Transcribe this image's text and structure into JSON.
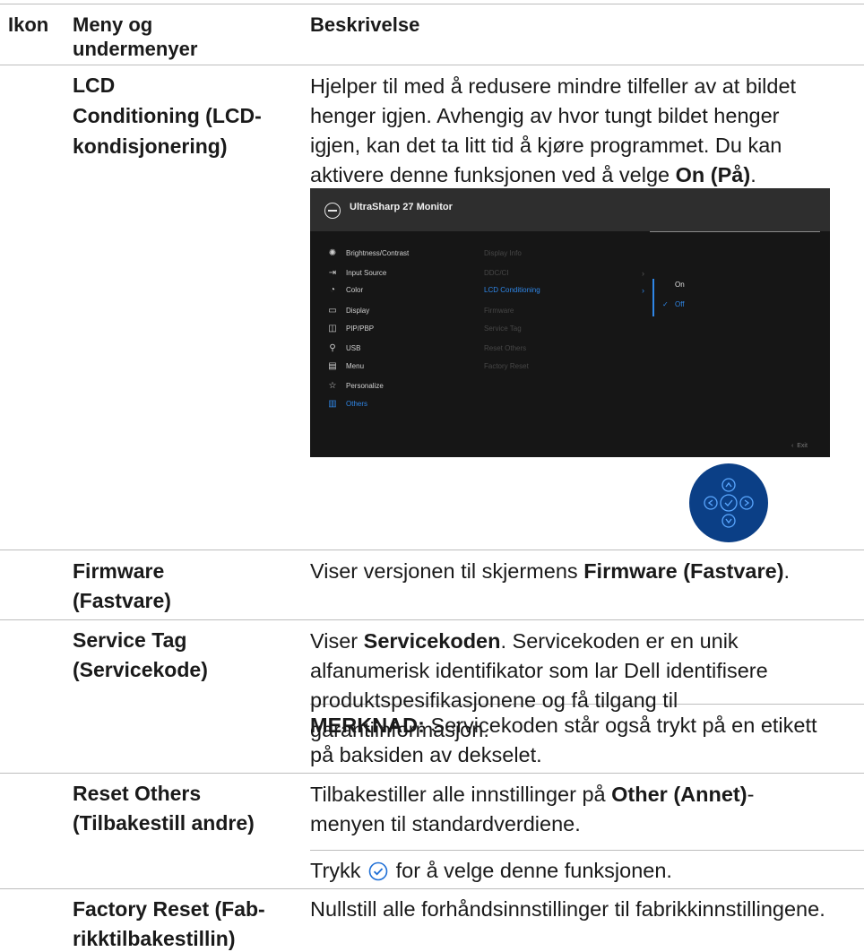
{
  "header": {
    "col_icon": "Ikon",
    "col_menu_line1": "Meny og",
    "col_menu_line2": "undermenyer",
    "col_desc": "Beskrivelse"
  },
  "rows": {
    "lcd": {
      "title_lines": [
        "LCD",
        "Conditioning (LCD-",
        "kondisjonering)"
      ],
      "desc_lines": [
        "Hjelper til med å redusere mindre tilfeller av at bildet",
        "henger igjen. Avhengig av hvor tungt bildet henger",
        "igjen, kan det ta litt tid å kjøre programmet. Du kan"
      ],
      "desc_last_prefix": "aktivere denne funksjonen ved å velge ",
      "desc_last_bold": "On (På)",
      "desc_last_suffix": "."
    },
    "firmware": {
      "title_lines": [
        "Firmware",
        "(Fastvare)"
      ],
      "desc_prefix": "Viser versjonen til skjermens ",
      "desc_bold": "Firmware (Fastvare)",
      "desc_suffix": "."
    },
    "service_tag": {
      "title_lines": [
        "Service Tag",
        "(Servicekode)"
      ],
      "desc_line1_prefix": "Viser ",
      "desc_line1_bold": "Servicekoden",
      "desc_line1_suffix": ". Servicekoden er en unik",
      "desc_lines": [
        "alfanumerisk identifikator som lar Dell identifisere",
        "produktspesifikasjonene og få tilgang til",
        "garantiinformasjon."
      ],
      "note_bold": "MERKNAD:",
      "note_line1": " Servicekoden står også trykt på en etikett",
      "note_line2": "på baksiden av dekselet."
    },
    "reset_others": {
      "title_lines": [
        "Reset Others",
        "(Tilbakestill andre)"
      ],
      "desc_line1_prefix": "Tilbakestiller alle innstillinger på ",
      "desc_line1_bold": "Other (Annet)",
      "desc_line1_suffix": "-",
      "desc_line2": "menyen til standardverdiene.",
      "press_prefix": "Trykk",
      "press_suffix": "for å velge denne funksjonen."
    },
    "factory_reset": {
      "title_lines": [
        "Factory Reset (Fab-",
        "rikktilbakestillin)"
      ],
      "desc": "Nullstill alle forhåndsinnstillinger til fabrikkinnstillingene."
    }
  },
  "osd": {
    "title": "UltraSharp 27 Monitor",
    "menu": [
      {
        "label": "Brightness/Contrast",
        "icon": "sun-icon"
      },
      {
        "label": "Input Source",
        "icon": "input-icon"
      },
      {
        "label": "Color",
        "icon": "palette-icon"
      },
      {
        "label": "Display",
        "icon": "display-icon"
      },
      {
        "label": "PIP/PBP",
        "icon": "pip-icon"
      },
      {
        "label": "USB",
        "icon": "usb-icon"
      },
      {
        "label": "Menu",
        "icon": "menu-icon"
      },
      {
        "label": "Personalize",
        "icon": "star-icon"
      },
      {
        "label": "Others",
        "icon": "others-icon",
        "active": true
      }
    ],
    "submenu": [
      "Display Info",
      "DDC/CI",
      "LCD Conditioning",
      "Firmware",
      "Service Tag",
      "Reset Others",
      "Factory Reset"
    ],
    "options": [
      "On",
      "Off"
    ],
    "selected_option": "Off",
    "exit": "Exit",
    "accent_color": "#2f86e6"
  },
  "joystick": {
    "color": "#0b3f86"
  }
}
